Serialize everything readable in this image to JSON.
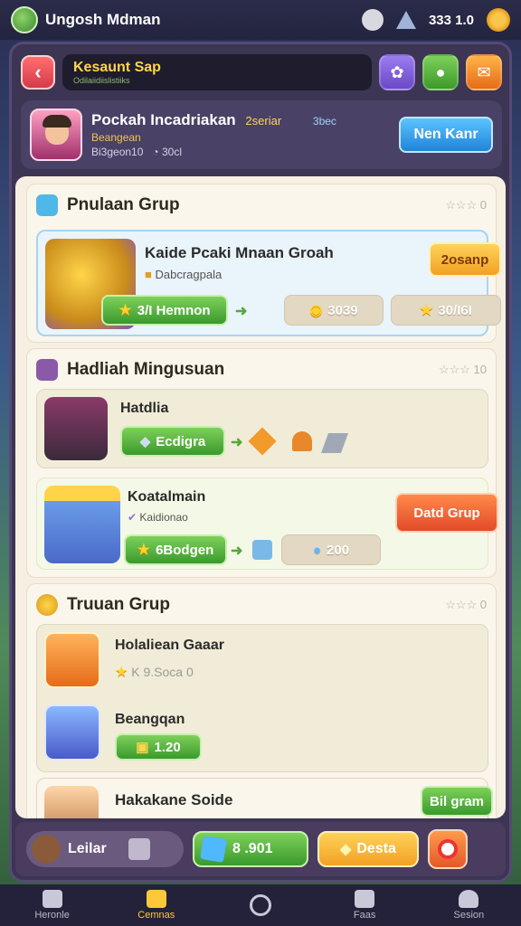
{
  "topbar": {
    "title": "Ungosh Mdman",
    "resource_value": "333 1.0",
    "icons": [
      "game-logo-icon",
      "moon-icon",
      "gem-icon",
      "gear-icon"
    ]
  },
  "header": {
    "title": "Kesaunt Sap",
    "subtitle": "Odilaiidiislistiiks",
    "buttons": [
      "flower-icon",
      "chat-icon",
      "mail-icon"
    ]
  },
  "profile": {
    "name": "Pockah Incadriakan",
    "tag": "2seriar",
    "tag2": "3bec",
    "line1": "Beangean",
    "line2a": "Bi3geon10",
    "line2b": "30cl",
    "button": "Nen Kanr"
  },
  "sections": [
    {
      "title": "Pnulaan Grup",
      "stars": "☆☆☆ 0",
      "cards": [
        {
          "title": "Kaide Pcaki Mnaan Groah",
          "subtitle": "Dabcragpala",
          "action": "2osanp",
          "reward1": "3/I Hemnon",
          "reward2": "3039",
          "reward3": "30/I6I"
        }
      ]
    },
    {
      "title": "Hadliah Mingusuan",
      "stars": "☆☆☆ 10",
      "cards": [
        {
          "title": "Hatdlia",
          "reward1": "Ecdigra"
        },
        {
          "title": "Koatalmain",
          "subtitle": "Kaidionao",
          "action": "Datd Grup",
          "reward1": "6Bodgen",
          "reward2": "200"
        }
      ]
    },
    {
      "title": "Truuan Grup",
      "stars": "☆☆☆ 0",
      "cards": [
        {
          "title": "Holaliean Gaaar",
          "stat": "K 9.Soca 0"
        },
        {
          "title": "Beangqan",
          "stat": "1.20"
        },
        {
          "title": "Hakakane Soide",
          "action": "Bil gram"
        }
      ]
    }
  ],
  "actionbar": {
    "left": "Leilar",
    "mid": "8 .901",
    "right": "Desta"
  },
  "nav": [
    {
      "label": "Heronle"
    },
    {
      "label": "Cemnas"
    },
    {
      "label": ""
    },
    {
      "label": "Faas"
    },
    {
      "label": "Sesion"
    }
  ],
  "colors": {
    "accent_green": "#3a9a2d",
    "accent_orange": "#f2a124",
    "accent_blue": "#1f84d8",
    "panel": "#f6efe2"
  }
}
